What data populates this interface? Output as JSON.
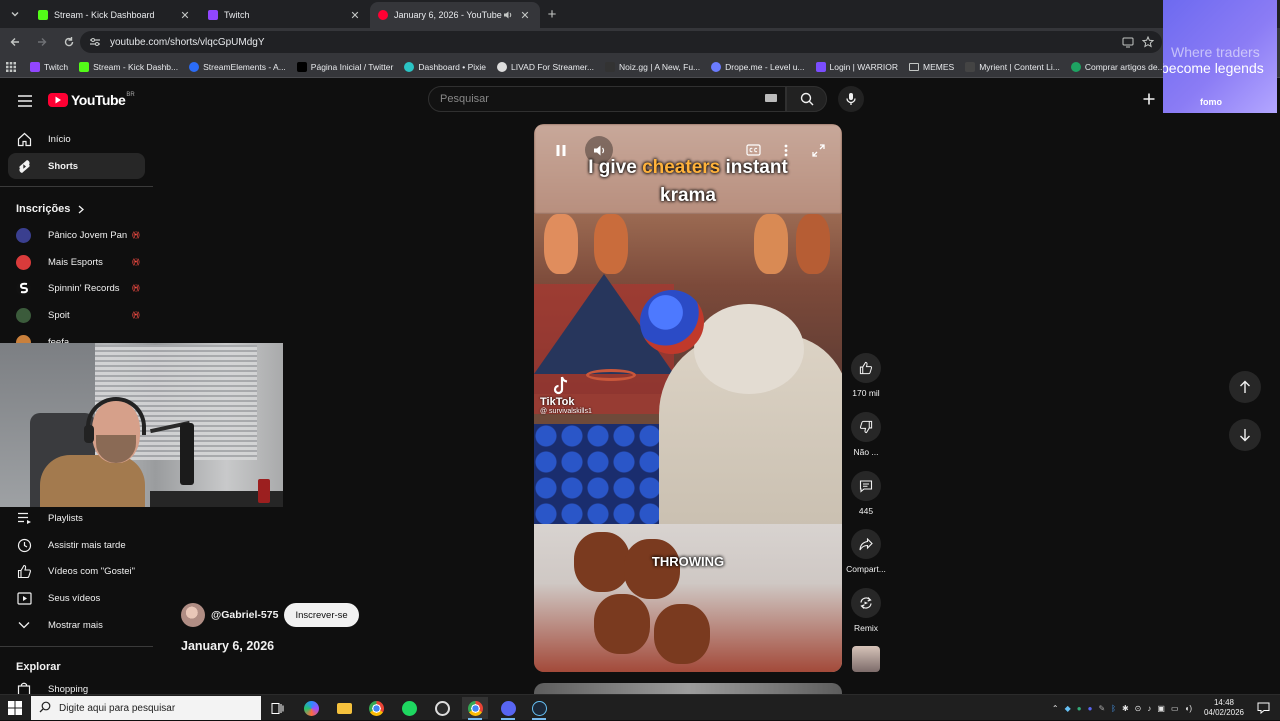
{
  "browser": {
    "tabs": [
      {
        "title": "Stream - Kick Dashboard",
        "color": "#53fc18"
      },
      {
        "title": "Twitch",
        "color": "#9146ff"
      },
      {
        "title": "January 6, 2026 - YouTube",
        "color": "#ff0033"
      }
    ],
    "url": "youtube.com/shorts/vlqcGpUMdgY",
    "bookmarks": [
      {
        "label": "Twitch",
        "color": "#9146ff"
      },
      {
        "label": "Stream - Kick Dashb...",
        "color": "#53fc18"
      },
      {
        "label": "StreamElements - A...",
        "color": "#2b6cf6"
      },
      {
        "label": "Página Inicial / Twitter",
        "color": "#000000"
      },
      {
        "label": "Dashboard • Pixie",
        "color": "#2bc4c4"
      },
      {
        "label": "LIVAD For Streamer...",
        "color": "#dddddd"
      },
      {
        "label": "Noiz.gg | A New, Fu...",
        "color": "#333333"
      },
      {
        "label": "Drope.me - Level u...",
        "color": "#6b7cff"
      },
      {
        "label": "Login | WARRIOR",
        "color": "#7b4dff"
      },
      {
        "label": "MEMES",
        "color": "#c4c7c5"
      },
      {
        "label": "Myrient | Content Li...",
        "color": "#444444"
      },
      {
        "label": "Comprar artigos de...",
        "color": "#1ea362"
      }
    ]
  },
  "ad": {
    "line1": "Where traders",
    "line2": "become legends",
    "brand": "fomo"
  },
  "youtube": {
    "logo": "YouTube",
    "country": "BR",
    "search_placeholder": "Pesquisar",
    "sidebar": {
      "main": [
        {
          "label": "Início",
          "icon": "home-icon"
        },
        {
          "label": "Shorts",
          "icon": "shorts-icon"
        }
      ],
      "subscriptions_title": "Inscrições",
      "subscriptions": [
        {
          "label": "Pânico Jovem Pan",
          "color": "#3a3f8f",
          "live": "((•))"
        },
        {
          "label": "Mais Esports",
          "color": "#d93b3b",
          "live": "((•))"
        },
        {
          "label": "Spinnin' Records",
          "color": "#111111",
          "live": "((•))"
        },
        {
          "label": "Spoit",
          "color": "#3b5b3b",
          "live": "((•))"
        },
        {
          "label": "feefa",
          "color": "#c9803c",
          "live": ""
        }
      ],
      "you": [
        {
          "label": "Playlists",
          "icon": "playlist-icon"
        },
        {
          "label": "Assistir mais tarde",
          "icon": "clock-icon"
        },
        {
          "label": "Vídeos com \"Gostei\"",
          "icon": "like-icon"
        },
        {
          "label": "Seus vídeos",
          "icon": "video-icon"
        },
        {
          "label": "Mostrar mais",
          "icon": "chevron-down-icon"
        }
      ],
      "explore_title": "Explorar",
      "explore": [
        {
          "label": "Shopping",
          "icon": "shopping-icon"
        }
      ]
    },
    "short": {
      "channel": "@Gabriel-575",
      "subscribe": "Inscrever-se",
      "title": "January 6, 2026",
      "caption_a": "I give",
      "caption_b": "cheaters",
      "caption_c": "instant",
      "caption_d": "krama",
      "caption_bottom": "THROWING",
      "watermark": "TikTok",
      "watermark_handle": "@ survivalskills1"
    },
    "actions": {
      "likes": "170 mil",
      "dislike": "Não ...",
      "comments": "445",
      "share": "Compart...",
      "remix": "Remix"
    }
  },
  "taskbar": {
    "search_placeholder": "Digite aqui para pesquisar",
    "time": "14:48",
    "date": "04/02/2026"
  }
}
